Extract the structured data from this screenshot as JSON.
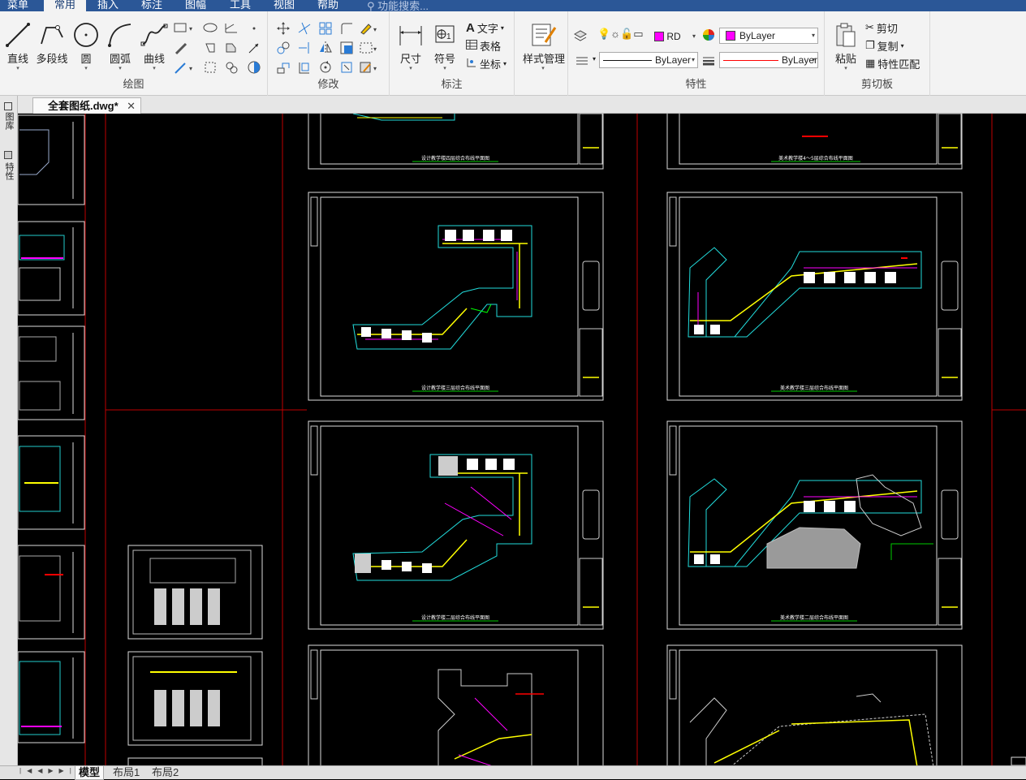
{
  "menubar": {
    "items": [
      "菜单",
      "常用",
      "插入",
      "标注",
      "图幅",
      "工具",
      "视图",
      "帮助"
    ],
    "active_index": 1,
    "search_placeholder": "功能搜索..."
  },
  "ribbon": {
    "draw": {
      "title": "绘图",
      "line": "直线",
      "polyline": "多段线",
      "circle": "圆",
      "arc": "圆弧",
      "curve": "曲线"
    },
    "modify": {
      "title": "修改"
    },
    "annotate": {
      "title": "标注",
      "dimension": "尺寸",
      "symbol": "符号",
      "text": "文字",
      "table": "表格",
      "coordinate": "坐标"
    },
    "style": {
      "title": "样式管理"
    },
    "properties": {
      "title": "特性",
      "layer_name": "RD",
      "color_value": "ByLayer",
      "linetype_value": "ByLayer",
      "lineweight_value": "ByLayer",
      "layer_color": "#ff00ff",
      "line_color": "#ff0000"
    },
    "clipboard": {
      "title": "剪切板",
      "paste": "粘贴",
      "cut": "剪切",
      "copy": "复制",
      "match": "特性匹配"
    }
  },
  "document_tab": {
    "name": "全套图纸.dwg*"
  },
  "side_panel": {
    "tab1": "图库",
    "tab2": "特性"
  },
  "drawing_sheets": {
    "s1": "设计教学楼四层综合布线平面图",
    "s2": "美术教学楼4～5层综合布线平面图",
    "s3": "设计教学楼三层综合布线平面图",
    "s4": "美术教学楼三层综合布线平面图",
    "s5": "设计教学楼二层综合布线平面图",
    "s6": "美术教学楼二层综合布线平面图"
  },
  "layout_tabs": [
    "模型",
    "布局1",
    "布局2"
  ]
}
